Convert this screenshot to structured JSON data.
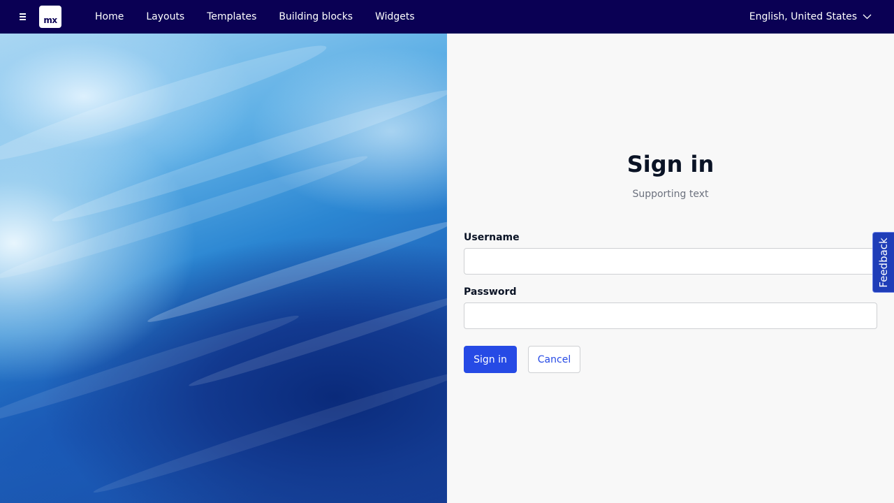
{
  "topbar": {
    "logo_text": "mx",
    "menu_icon": "hamburger-menu-icon",
    "nav": [
      {
        "label": "Home"
      },
      {
        "label": "Layouts"
      },
      {
        "label": "Templates"
      },
      {
        "label": "Building blocks"
      },
      {
        "label": "Widgets"
      }
    ],
    "language": "English, United States",
    "language_icon": "chevron-down-icon",
    "background_color": "#0a0054"
  },
  "hero": {
    "image": "ocean-waves"
  },
  "signin": {
    "title": "Sign in",
    "subtitle": "Supporting text",
    "username_label": "Username",
    "username_value": "",
    "password_label": "Password",
    "password_value": "",
    "submit_label": "Sign in",
    "cancel_label": "Cancel",
    "primary_color": "#264ae5"
  },
  "feedback": {
    "label": "Feedback"
  }
}
